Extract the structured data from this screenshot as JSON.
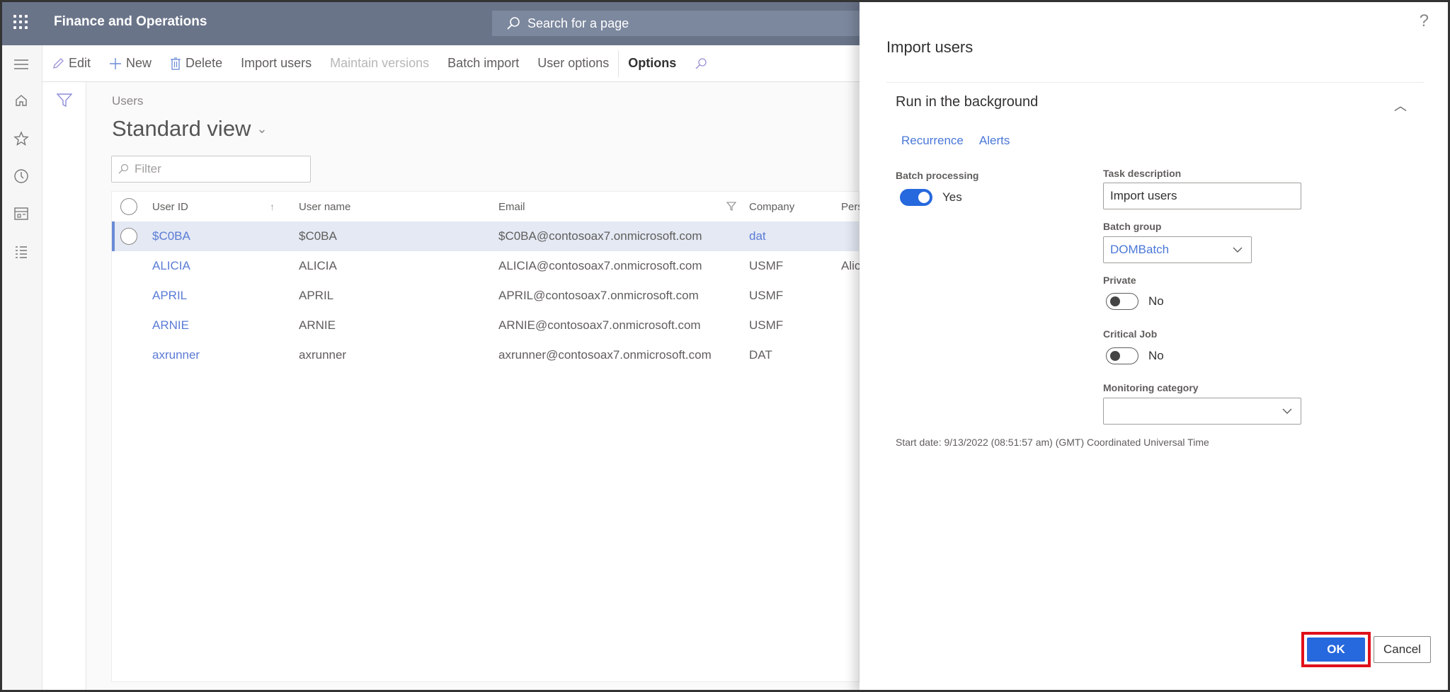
{
  "app": {
    "title": "Finance and Operations",
    "search_placeholder": "Search for a page"
  },
  "toolbar": {
    "edit": "Edit",
    "new": "New",
    "delete": "Delete",
    "import_users": "Import users",
    "maintain_versions": "Maintain versions",
    "batch_import": "Batch import",
    "user_options": "User options",
    "options": "Options"
  },
  "leftnav": {
    "icons": [
      "hamburger-icon",
      "home-icon",
      "star-icon",
      "clock-icon",
      "workspace-icon",
      "list-icon"
    ]
  },
  "page": {
    "breadcrumb": "Users",
    "view_name": "Standard view",
    "filter_placeholder": "Filter"
  },
  "grid": {
    "columns": {
      "user_id": "User ID",
      "user_name": "User name",
      "email": "Email",
      "company": "Company",
      "person": "Pers"
    },
    "rows": [
      {
        "user_id": "$C0BA",
        "user_name": "$C0BA",
        "email": "$C0BA@contosoax7.onmicrosoft.com",
        "company": "dat",
        "person": "",
        "selected": true
      },
      {
        "user_id": "ALICIA",
        "user_name": "ALICIA",
        "email": "ALICIA@contosoax7.onmicrosoft.com",
        "company": "USMF",
        "person": "Alic",
        "selected": false
      },
      {
        "user_id": "APRIL",
        "user_name": "APRIL",
        "email": "APRIL@contosoax7.onmicrosoft.com",
        "company": "USMF",
        "person": "",
        "selected": false
      },
      {
        "user_id": "ARNIE",
        "user_name": "ARNIE",
        "email": "ARNIE@contosoax7.onmicrosoft.com",
        "company": "USMF",
        "person": "",
        "selected": false
      },
      {
        "user_id": "axrunner",
        "user_name": "axrunner",
        "email": "axrunner@contosoax7.onmicrosoft.com",
        "company": "DAT",
        "person": "",
        "selected": false
      }
    ]
  },
  "panel": {
    "help": "?",
    "title": "Import users",
    "section_title": "Run in the background",
    "tabs": [
      "Recurrence",
      "Alerts"
    ],
    "batch_processing": {
      "label": "Batch processing",
      "value": "Yes",
      "on": true
    },
    "task_description": {
      "label": "Task description",
      "value": "Import users"
    },
    "batch_group": {
      "label": "Batch group",
      "value": "DOMBatch"
    },
    "private": {
      "label": "Private",
      "value": "No",
      "on": false
    },
    "critical_job": {
      "label": "Critical Job",
      "value": "No",
      "on": false
    },
    "monitoring_category": {
      "label": "Monitoring category",
      "value": ""
    },
    "start_date": "Start date: 9/13/2022 (08:51:57 am) (GMT) Coordinated Universal Time",
    "ok_label": "OK",
    "cancel_label": "Cancel"
  },
  "colors": {
    "header_bg": "#6a7489",
    "accent": "#2668dd",
    "link": "#5b7bd5",
    "highlight": "#e0101b",
    "selected_row": "#e4e9f4"
  }
}
